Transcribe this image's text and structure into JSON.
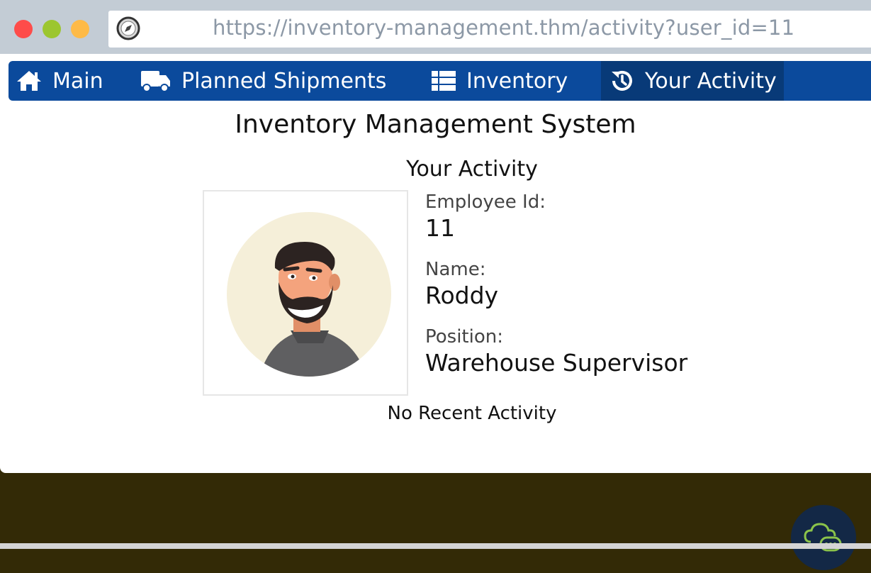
{
  "browser": {
    "url": "https://inventory-management.thm/activity?user_id=11"
  },
  "nav": {
    "items": [
      {
        "label": "Main",
        "icon": "home-icon"
      },
      {
        "label": "Planned Shipments",
        "icon": "truck-icon"
      },
      {
        "label": "Inventory",
        "icon": "list-icon"
      },
      {
        "label": "Your Activity",
        "icon": "history-icon",
        "active": true
      }
    ]
  },
  "page": {
    "title": "Inventory Management System",
    "subtitle": "Your Activity"
  },
  "employee": {
    "id_label": "Employee Id:",
    "id_value": "11",
    "name_label": "Name:",
    "name_value": "Roddy",
    "position_label": "Position:",
    "position_value": "Warehouse Supervisor"
  },
  "activity": {
    "empty_message": "No Recent Activity"
  },
  "colors": {
    "nav_bg": "#0b4a9c",
    "nav_active_bg": "#083a78",
    "titlebar_bg": "#c3ccd5",
    "footer_bg": "#332a06"
  }
}
